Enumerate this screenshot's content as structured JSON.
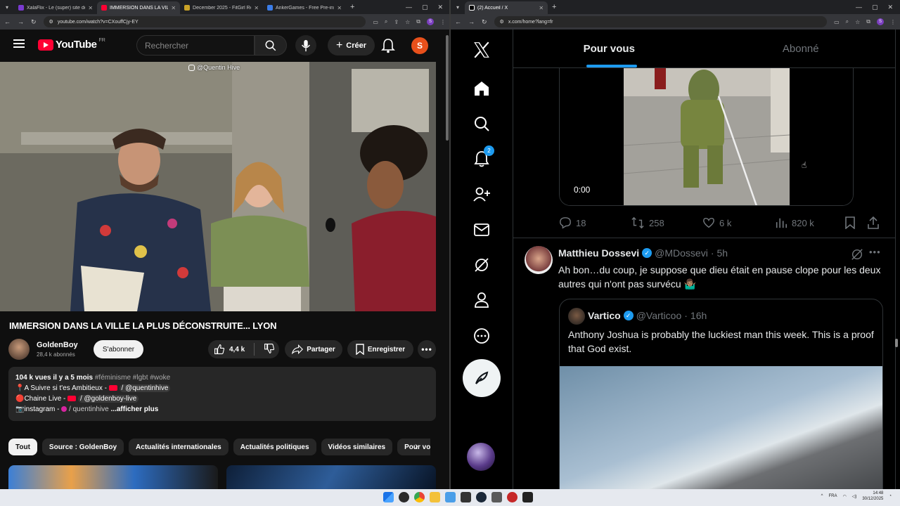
{
  "left_browser": {
    "tabs": [
      {
        "title": "XalaFlix - Le (super) site de stre",
        "color": "#7a3ad1",
        "active": false
      },
      {
        "title": "IMMERSION DANS LA VILL",
        "color": "#ff0033",
        "active": true
      },
      {
        "title": "December 2025 - FitGirl Repack",
        "color": "#c9a227",
        "active": false
      },
      {
        "title": "AnkerGames - Free Pre-installe",
        "color": "#3b7de8",
        "active": false
      }
    ],
    "url": "youtube.com/watch?v=CXouffCjy-EY",
    "profile": "S"
  },
  "youtube": {
    "logo_text": "YouTube",
    "logo_region": "FR",
    "search_placeholder": "Rechercher",
    "create_label": "Créer",
    "avatar_letter": "S",
    "watermark": "@Quentin Hive",
    "video_title": "IMMERSION DANS LA VILLE LA PLUS DÉCONSTRUITE... LYON",
    "channel_name": "GoldenBoy",
    "channel_subs": "28,4 k abonnés",
    "subscribe_label": "S'abonner",
    "likes": "4,4 k",
    "share_label": "Partager",
    "save_label": "Enregistrer",
    "description": {
      "views": "104 k vues",
      "age": "il y a 5 mois",
      "tags": "#féminisme #lgbt #woke",
      "line1": "📍A Suivre si t'es Ambitieux -",
      "line1_handle": "/ @quentinhive",
      "line2": "🔴Chaine Live -",
      "line2_handle": "/ @goldenboy-live",
      "line3": "📷instagram -",
      "line3_handle": "/ quentinhive",
      "more": "...afficher plus"
    },
    "chips": [
      "Tout",
      "Source : GoldenBoy",
      "Actualités internationales",
      "Actualités politiques",
      "Vidéos similaires",
      "Pour vous"
    ]
  },
  "right_browser": {
    "tabs": [
      {
        "title": "(2) Accueil / X",
        "active": true
      }
    ],
    "url": "x.com/home?lang=fr",
    "profile": "S"
  },
  "x": {
    "notif_count": "2",
    "tabs": [
      "Pour vous",
      "Abonné"
    ],
    "video_time": "0:00",
    "post1_stats": {
      "replies": "18",
      "reposts": "258",
      "likes": "6 k",
      "views": "820 k"
    },
    "post2": {
      "name": "Matthieu Dossevi",
      "handle": "@MDossevi",
      "time": "5h",
      "text": "Ah bon…du coup, je suppose que dieu était en pause clope pour les deux autres qui n'ont pas survécu 🤷🏽‍♂️"
    },
    "quote": {
      "name": "Vartico",
      "handle": "@Varticoo",
      "time": "16h",
      "text": "Anthony Joshua is probably the luckiest man this week. This is a proof that God exist."
    }
  },
  "taskbar": {
    "lang": "FRA",
    "time": "14:48",
    "date": "30/12/2025"
  }
}
